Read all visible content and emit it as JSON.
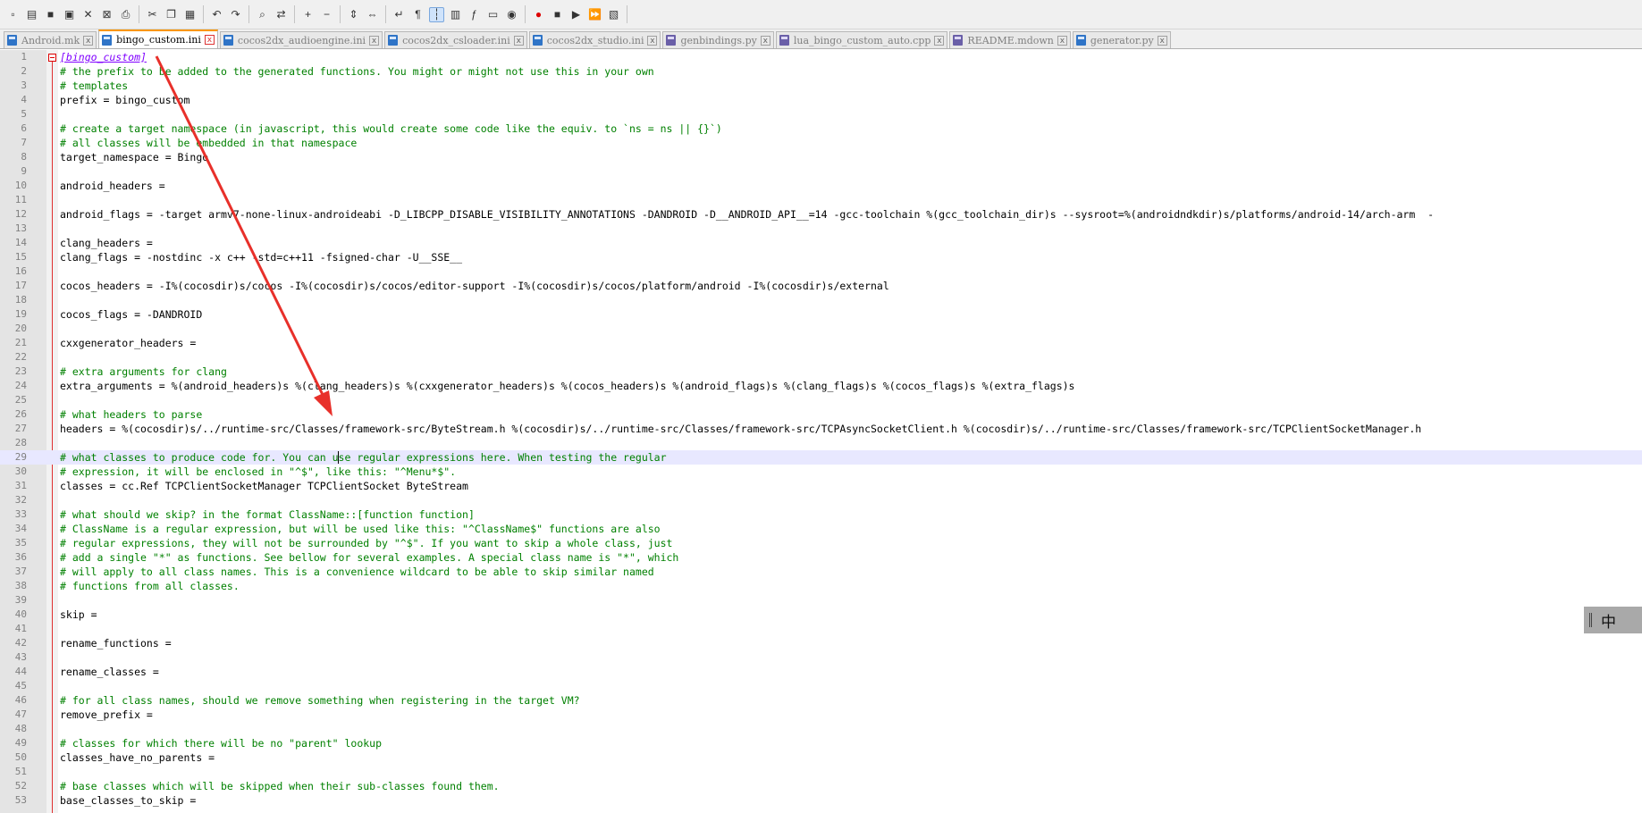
{
  "toolbar": {
    "icons": [
      "new-file-icon",
      "open-file-icon",
      "save-icon",
      "save-all-icon",
      "close-icon",
      "close-all-icon",
      "print-icon",
      "cut-icon",
      "copy-icon",
      "paste-icon",
      "undo-icon",
      "redo-icon",
      "find-icon",
      "replace-icon",
      "zoom-in-icon",
      "zoom-out-icon",
      "sync-v-icon",
      "sync-h-icon",
      "wrap-icon",
      "show-all-icon",
      "indent-guide-icon",
      "doc-map-icon",
      "function-list-icon",
      "folder-icon",
      "monitor-icon",
      "record-icon",
      "stop-icon",
      "play-icon",
      "play-multiple-icon",
      "save-macro-icon"
    ]
  },
  "tabs": [
    {
      "label": "Android.mk",
      "icon": "blue",
      "active": false
    },
    {
      "label": "bingo_custom.ini",
      "icon": "blue",
      "active": true
    },
    {
      "label": "cocos2dx_audioengine.ini",
      "icon": "blue",
      "active": false
    },
    {
      "label": "cocos2dx_csloader.ini",
      "icon": "blue",
      "active": false
    },
    {
      "label": "cocos2dx_studio.ini",
      "icon": "blue",
      "active": false
    },
    {
      "label": "genbindings.py",
      "icon": "purple",
      "active": false
    },
    {
      "label": "lua_bingo_custom_auto.cpp",
      "icon": "purple",
      "active": false
    },
    {
      "label": "README.mdown",
      "icon": "purple",
      "active": false
    },
    {
      "label": "generator.py",
      "icon": "blue",
      "active": false
    }
  ],
  "tab_close_glyph": "x",
  "editor": {
    "current_line": 29,
    "lines": [
      {
        "n": "1",
        "t": "[bingo_custom]",
        "k": "section"
      },
      {
        "n": "2",
        "t": "# the prefix to be added to the generated functions. You might or might not use this in your own",
        "k": "comment"
      },
      {
        "n": "3",
        "t": "# templates",
        "k": "comment"
      },
      {
        "n": "4",
        "t": "prefix = bingo_custom",
        "k": "kv"
      },
      {
        "n": "5",
        "t": "",
        "k": "blank"
      },
      {
        "n": "6",
        "t": "# create a target namespace (in javascript, this would create some code like the equiv. to `ns = ns || {}`)",
        "k": "comment"
      },
      {
        "n": "7",
        "t": "# all classes will be embedded in that namespace",
        "k": "comment"
      },
      {
        "n": "8",
        "t": "target_namespace = Bingo",
        "k": "kv"
      },
      {
        "n": "9",
        "t": "",
        "k": "blank"
      },
      {
        "n": "10",
        "t": "android_headers = ",
        "k": "kv"
      },
      {
        "n": "11",
        "t": "",
        "k": "blank"
      },
      {
        "n": "12",
        "t": "android_flags = -target armv7-none-linux-androideabi -D_LIBCPP_DISABLE_VISIBILITY_ANNOTATIONS -DANDROID -D__ANDROID_API__=14 -gcc-toolchain %(gcc_toolchain_dir)s --sysroot=%(androidndkdir)s/platforms/android-14/arch-arm  -",
        "k": "kv"
      },
      {
        "n": "13",
        "t": "",
        "k": "blank"
      },
      {
        "n": "14",
        "t": "clang_headers = ",
        "k": "kv"
      },
      {
        "n": "15",
        "t": "clang_flags = -nostdinc -x c++ -std=c++11 -fsigned-char -U__SSE__",
        "k": "kv"
      },
      {
        "n": "16",
        "t": "",
        "k": "blank"
      },
      {
        "n": "17",
        "t": "cocos_headers = -I%(cocosdir)s/cocos -I%(cocosdir)s/cocos/editor-support -I%(cocosdir)s/cocos/platform/android -I%(cocosdir)s/external",
        "k": "kv"
      },
      {
        "n": "18",
        "t": "",
        "k": "blank"
      },
      {
        "n": "19",
        "t": "cocos_flags = -DANDROID",
        "k": "kv"
      },
      {
        "n": "20",
        "t": "",
        "k": "blank"
      },
      {
        "n": "21",
        "t": "cxxgenerator_headers = ",
        "k": "kv"
      },
      {
        "n": "22",
        "t": "",
        "k": "blank"
      },
      {
        "n": "23",
        "t": "# extra arguments for clang",
        "k": "comment"
      },
      {
        "n": "24",
        "t": "extra_arguments = %(android_headers)s %(clang_headers)s %(cxxgenerator_headers)s %(cocos_headers)s %(android_flags)s %(clang_flags)s %(cocos_flags)s %(extra_flags)s",
        "k": "kv"
      },
      {
        "n": "25",
        "t": "",
        "k": "blank"
      },
      {
        "n": "26",
        "t": "# what headers to parse",
        "k": "comment"
      },
      {
        "n": "27",
        "t": "headers = %(cocosdir)s/../runtime-src/Classes/framework-src/ByteStream.h %(cocosdir)s/../runtime-src/Classes/framework-src/TCPAsyncSocketClient.h %(cocosdir)s/../runtime-src/Classes/framework-src/TCPClientSocketManager.h",
        "k": "kv"
      },
      {
        "n": "28",
        "t": "",
        "k": "blank"
      },
      {
        "n": "29",
        "t": "# what classes to produce code for. You can use regular expressions here. When testing the regular",
        "k": "comment"
      },
      {
        "n": "30",
        "t": "# expression, it will be enclosed in \"^$\", like this: \"^Menu*$\".",
        "k": "comment"
      },
      {
        "n": "31",
        "t": "classes = cc.Ref TCPClientSocketManager TCPClientSocket ByteStream",
        "k": "kv"
      },
      {
        "n": "32",
        "t": "",
        "k": "blank"
      },
      {
        "n": "33",
        "t": "# what should we skip? in the format ClassName::[function function]",
        "k": "comment"
      },
      {
        "n": "34",
        "t": "# ClassName is a regular expression, but will be used like this: \"^ClassName$\" functions are also",
        "k": "comment"
      },
      {
        "n": "35",
        "t": "# regular expressions, they will not be surrounded by \"^$\". If you want to skip a whole class, just",
        "k": "comment"
      },
      {
        "n": "36",
        "t": "# add a single \"*\" as functions. See bellow for several examples. A special class name is \"*\", which",
        "k": "comment"
      },
      {
        "n": "37",
        "t": "# will apply to all class names. This is a convenience wildcard to be able to skip similar named",
        "k": "comment"
      },
      {
        "n": "38",
        "t": "# functions from all classes.",
        "k": "comment"
      },
      {
        "n": "39",
        "t": "",
        "k": "blank"
      },
      {
        "n": "40",
        "t": "skip = ",
        "k": "kv"
      },
      {
        "n": "41",
        "t": "",
        "k": "blank"
      },
      {
        "n": "42",
        "t": "rename_functions = ",
        "k": "kv"
      },
      {
        "n": "43",
        "t": "",
        "k": "blank"
      },
      {
        "n": "44",
        "t": "rename_classes = ",
        "k": "kv"
      },
      {
        "n": "45",
        "t": "",
        "k": "blank"
      },
      {
        "n": "46",
        "t": "# for all class names, should we remove something when registering in the target VM?",
        "k": "comment"
      },
      {
        "n": "47",
        "t": "remove_prefix = ",
        "k": "kv"
      },
      {
        "n": "48",
        "t": "",
        "k": "blank"
      },
      {
        "n": "49",
        "t": "# classes for which there will be no \"parent\" lookup",
        "k": "comment"
      },
      {
        "n": "50",
        "t": "classes_have_no_parents = ",
        "k": "kv"
      },
      {
        "n": "51",
        "t": "",
        "k": "blank"
      },
      {
        "n": "52",
        "t": "# base classes which will be skipped when their sub-classes found them.",
        "k": "comment"
      },
      {
        "n": "53",
        "t": "base_classes_to_skip = ",
        "k": "kv"
      }
    ]
  },
  "ime": {
    "label": "中"
  },
  "colors": {
    "comment": "#008000",
    "section": "#8000ff",
    "annotation_arrow": "#e8302a",
    "active_tab_accent": "#fa9600",
    "current_line_bg": "#e8e8ff"
  }
}
